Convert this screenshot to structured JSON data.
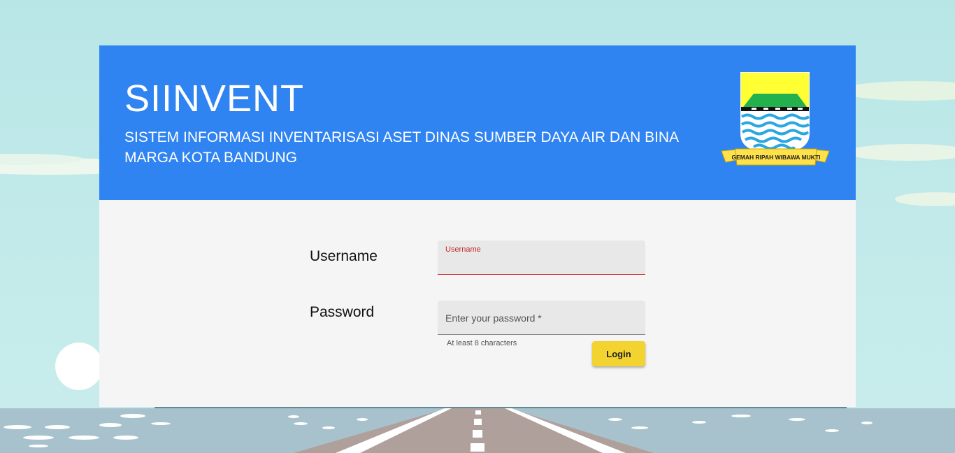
{
  "header": {
    "title": "SIINVENT",
    "subtitle": "SISTEM INFORMASI INVENTARISASI ASET DINAS SUMBER DAYA AIR DAN BINA MARGA KOTA BANDUNG",
    "logo_motto": "GEMAH RIPAH WIBAWA MUKTI"
  },
  "login_form": {
    "username_label": "Username",
    "username_floating_label": "Username",
    "username_value": "",
    "password_label": "Password",
    "password_placeholder": "Enter your password *",
    "password_value": "",
    "password_hint": "At least 8 characters",
    "login_button": "Login"
  },
  "colors": {
    "header_blue": "#3084f2",
    "button_yellow": "#f2d330",
    "error_red": "#c62828",
    "sky": "#b8e6e7"
  }
}
